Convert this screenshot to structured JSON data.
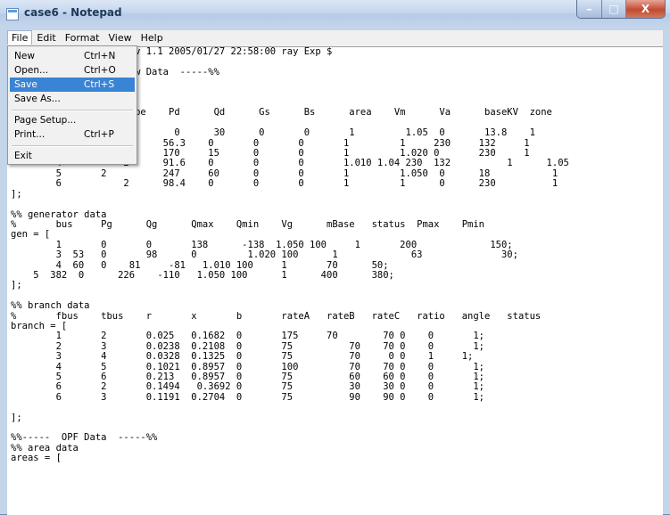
{
  "window": {
    "title": "case6 - Notepad",
    "buttons": {
      "minimize": "–",
      "maximize": "□",
      "close": "X"
    }
  },
  "menubar": [
    "File",
    "Edit",
    "Format",
    "View",
    "Help"
  ],
  "file_menu": {
    "items": [
      {
        "label": "New",
        "shortcut": "Ctrl+N"
      },
      {
        "label": "Open...",
        "shortcut": "Ctrl+O"
      },
      {
        "label": "Save",
        "shortcut": "Ctrl+S",
        "highlighted": true
      },
      {
        "label": "Save As...",
        "shortcut": ""
      },
      {
        "label": "Page Setup...",
        "shortcut": ""
      },
      {
        "label": "Print...",
        "shortcut": "Ctrl+P"
      },
      {
        "label": "Exit",
        "shortcut": ""
      }
    ]
  },
  "editor": {
    "lines": [
      "                      v 1.1 2005/01/27 22:58:00 ray Exp $",
      "",
      "                      w Data  -----%%",
      "",
      "",
      "",
      "                      pe    Pd      Qd      Gs      Bs      area    Vm      Va      baseKV  zone",
      "",
      "                             0      30      0       0       1         1.05  0       13.8    1",
      "                    1      56.3    0       0       0       1         1     230     132     1",
      "        3           2      170     15      0       0       1         1.020 0       230     1",
      "        4           2      91.6    0       0       0       1.010 1.04 230  132          1      1.05",
      "        5       2          247     60      0       0       1         1.050  0      18           1",
      "        6           2      98.4    0       0       0       1         1      0      230          1",
      "];",
      "",
      "%% generator data",
      "%       bus     Pg      Qg      Qmax    Qmin    Vg      mBase   status  Pmax    Pmin",
      "gen = [",
      "        1       0       0       138      -138  1.050 100     1       200             150;",
      "        3  53   0       98      0         1.020 100      1             63              30;",
      "        4  60   0    81     -81   1.010 100     1       70      50;",
      "    5  382  0      226    -110   1.050 100      1      400      380;",
      "];",
      "",
      "%% branch data",
      "%       fbus    tbus    r       x       b       rateA   rateB   rateC   ratio   angle   status",
      "branch = [",
      "        1       2       0.025   0.1682  0       175     70        70 0    0       1;",
      "        2       3       0.0238  0.2108  0       75          70    70 0    0       1;",
      "        3       4       0.0328  0.1325  0       75          70     0 0    1     1;",
      "        4       5       0.1021  0.8957  0       100         70    70 0    0       1;",
      "        5       6       0.213   0.8957  0       75          60    60 0    0       1;",
      "        6       2       0.1494   0.3692 0       75          30    30 0    0       1;",
      "        6       3       0.1191  0.2704  0       75          90    90 0    0       1;",
      "",
      "];",
      "",
      "%%-----  OPF Data  -----%%",
      "%% area data",
      "areas = ["
    ]
  }
}
